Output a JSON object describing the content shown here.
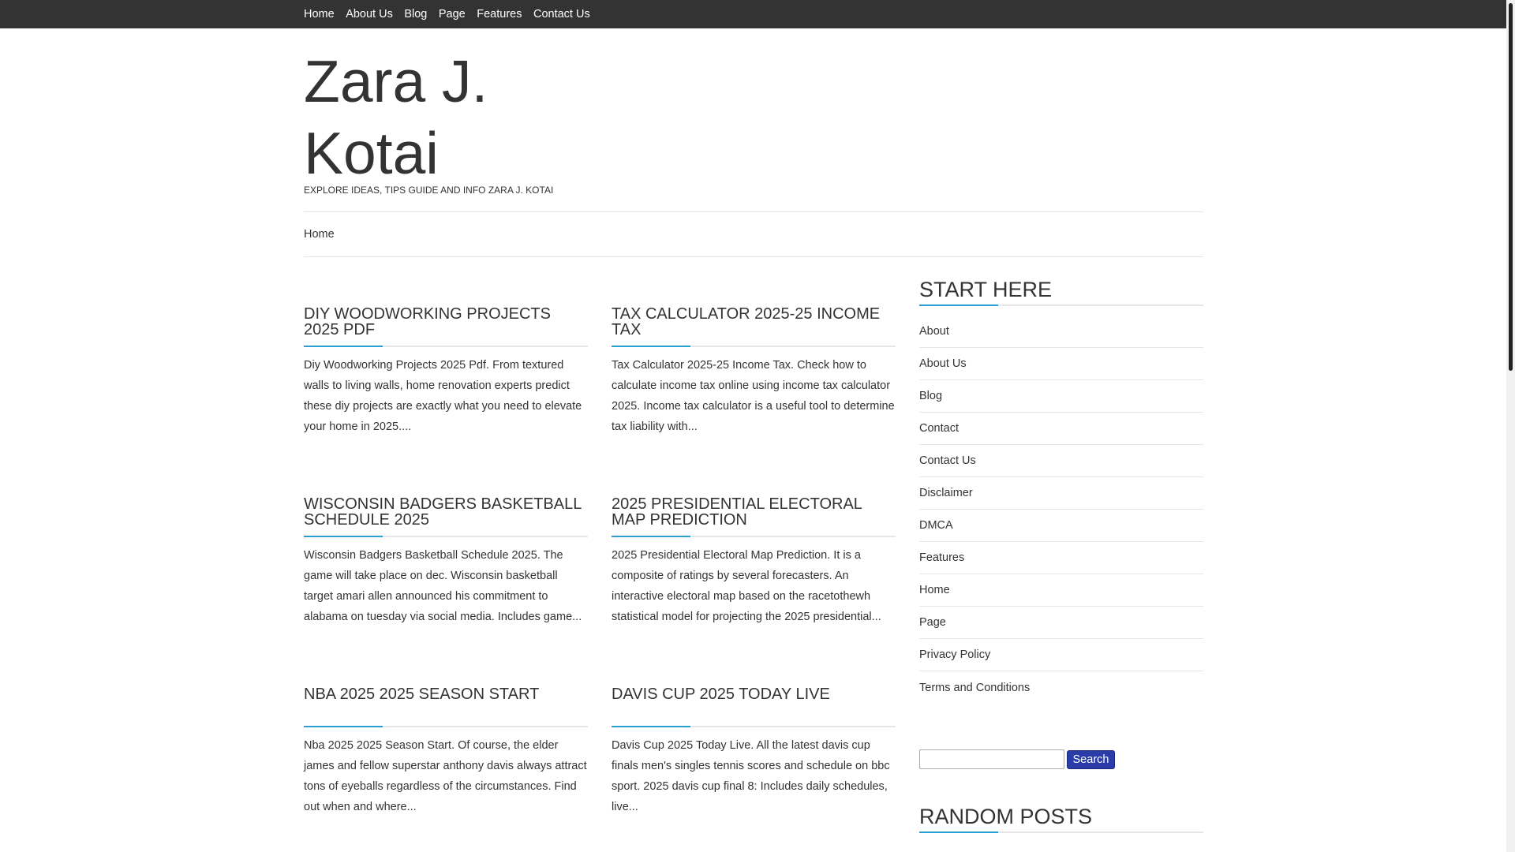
{
  "topnav": [
    "Home",
    "About Us",
    "Blog",
    "Page",
    "Features",
    "Contact Us"
  ],
  "site": {
    "title": "Zara J. Kotai",
    "tagline": "EXPLORE IDEAS, TIPS GUIDE AND INFO ZARA J. KOTAI"
  },
  "mainnav": {
    "home": "Home"
  },
  "posts": [
    {
      "title": "DIY WOODWORKING PROJECTS 2025 PDF",
      "excerpt": "Diy Woodworking Projects 2025 Pdf. From textured walls to living walls, home renovation experts predict these diy projects are exactly what you need to elevate your home in 2025...."
    },
    {
      "title": "TAX CALCULATOR 2025-25 INCOME TAX",
      "excerpt": "Tax Calculator 2025-25 Income Tax. Check how to calculate income tax online using income tax calculator 2025. Income tax calculator is a useful tool to determine tax liability with..."
    },
    {
      "title": "WISCONSIN BADGERS BASKETBALL SCHEDULE 2025",
      "excerpt": "Wisconsin Badgers Basketball Schedule 2025. The game will take place on dec. Wisconsin basketball target amari allen announced his commitment to alabama on tuesday via social media. Includes game..."
    },
    {
      "title": "2025 PRESIDENTIAL ELECTORAL MAP PREDICTION",
      "excerpt": "2025 Presidential Electoral Map Prediction. It is a composite of ratings by several forecasters. An interactive electoral map based on the racetothewh statistical model for projecting the 2025 presidential..."
    },
    {
      "title": "NBA 2025 2025 SEASON START",
      "excerpt": "Nba 2025 2025 Season Start. Of course, the elder james and fellow superstar anthony davis always attract tons of eyeballs regardless of the circumstances. Find out when and where..."
    },
    {
      "title": "DAVIS CUP 2025 TODAY LIVE",
      "excerpt": "Davis Cup 2025 Today Live. All the latest davis cup finals men's singles tennis scores and schedule on bbc sport. 2025 davis cup final 8: Includes daily schedules, live..."
    }
  ],
  "sidebar": {
    "start_title": "START HERE",
    "pages": [
      "About",
      "About Us",
      "Blog",
      "Contact",
      "Contact Us",
      "Disclaimer",
      "DMCA",
      "Features",
      "Home",
      "Page",
      "Privacy Policy",
      "Terms and Conditions"
    ],
    "search_label": "Search",
    "search_value": "",
    "random_title": "RANDOM POSTS"
  },
  "colors": {
    "topbar": "#333333",
    "accent": "#2a9fd6",
    "search_button": "#2a3ca8"
  }
}
